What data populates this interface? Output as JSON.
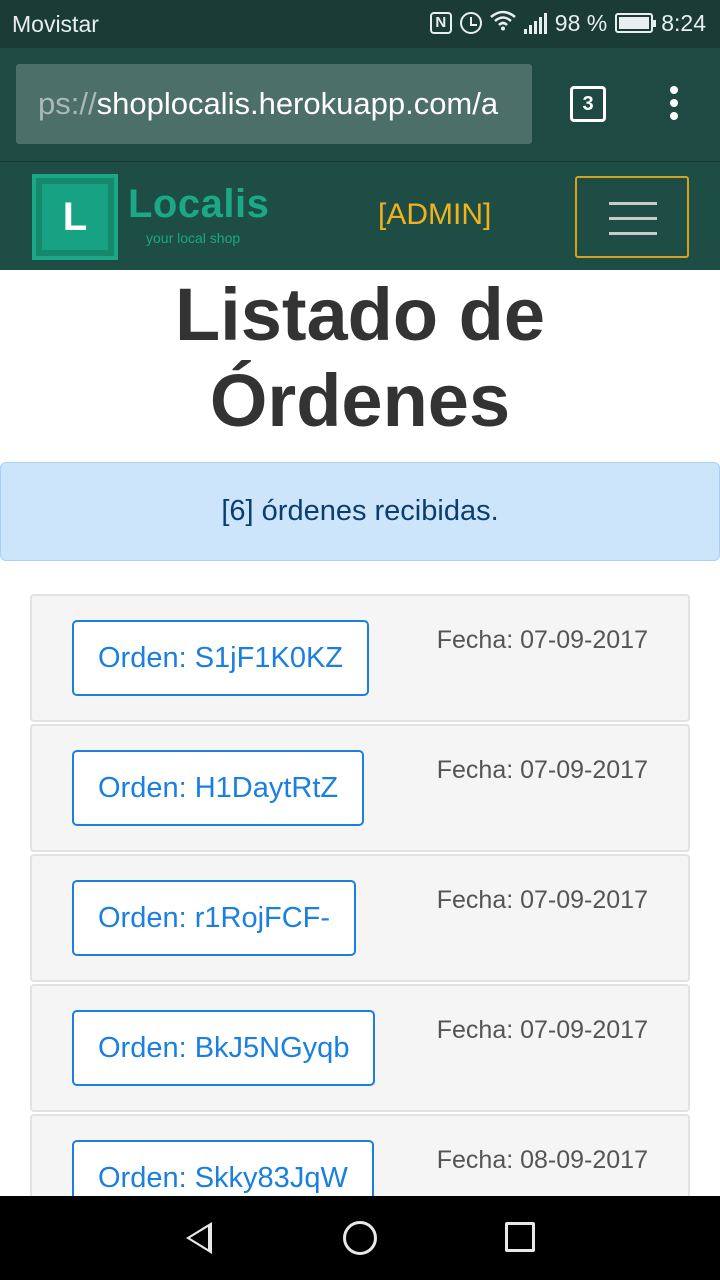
{
  "status_bar": {
    "carrier": "Movistar",
    "battery_text": "98 %",
    "battery_level": 0.98,
    "time": "8:24",
    "icons": [
      "nfc-icon",
      "alarm-icon",
      "wifi-icon",
      "signal-icon",
      "battery-icon"
    ]
  },
  "browser": {
    "url_scheme": "ps://",
    "url_host": "shoplocalis.herokuapp.com/a",
    "tab_count": "3",
    "menu_icon": "more-vert-icon"
  },
  "site_nav": {
    "logo_letter": "L",
    "logo_name": "Localis",
    "logo_tagline": "your local shop",
    "admin_label": "[ADMIN]",
    "menu_icon": "hamburger-icon",
    "colors": {
      "brand": "#1aa886",
      "admin": "#f0b31c",
      "nav_bg": "#1e4d45"
    }
  },
  "page": {
    "title_line1": "Listado de",
    "title_line2": "Órdenes",
    "alert_text": "[6] órdenes recibidas."
  },
  "orders": [
    {
      "label": "Orden: S1jF1K0KZ",
      "date": "Fecha: 07-09-2017"
    },
    {
      "label": "Orden: H1DaytRtZ",
      "date": "Fecha: 07-09-2017"
    },
    {
      "label": "Orden: r1RojFCF-",
      "date": "Fecha: 07-09-2017"
    },
    {
      "label": "Orden: BkJ5NGyqb",
      "date": "Fecha: 07-09-2017"
    },
    {
      "label": "Orden: Skky83JqW",
      "date": "Fecha: 08-09-2017"
    }
  ],
  "android_nav": {
    "icons": [
      "back-icon",
      "home-icon",
      "recents-icon"
    ]
  }
}
